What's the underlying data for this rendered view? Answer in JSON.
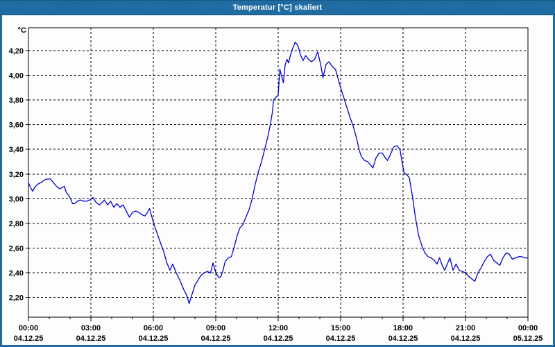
{
  "window": {
    "title": "Temperatur [°C] skaliert",
    "titlebar_color": "#1C6BA4",
    "border_color": "#1C6BA4",
    "background_color": "#FDFDFD"
  },
  "chart_data": {
    "type": "line",
    "title": "Temperatur [°C] skaliert",
    "unit_label": "°C",
    "line_color": "#0000CC",
    "grid": "dashed black, horizontal at every 0.20 °C, vertical at every 3 h",
    "legend_position": "none",
    "x_axis": {
      "range_hours": [
        0,
        24
      ],
      "minor_tick_interval_hours": 1,
      "tick_hours": [
        0,
        3,
        6,
        9,
        12,
        15,
        18,
        21,
        24
      ],
      "ticks": [
        {
          "time": "00:00",
          "date": "04.12.25"
        },
        {
          "time": "03:00",
          "date": "04.12.25"
        },
        {
          "time": "06:00",
          "date": "04.12.25"
        },
        {
          "time": "09:00",
          "date": "04.12.25"
        },
        {
          "time": "12:00",
          "date": "04.12.25"
        },
        {
          "time": "15:00",
          "date": "04.12.25"
        },
        {
          "time": "18:00",
          "date": "04.12.25"
        },
        {
          "time": "21:00",
          "date": "04.12.25"
        },
        {
          "time": "00:00",
          "date": "05.12.25"
        }
      ]
    },
    "y_axis": {
      "range": [
        1.78,
        4.39
      ],
      "tick_values": [
        2.2,
        2.4,
        2.6,
        2.8,
        3.0,
        3.2,
        3.4,
        3.6,
        3.8,
        4.0,
        4.2
      ],
      "tick_labels": [
        "2,20",
        "2,40",
        "2,60",
        "2,80",
        "3,00",
        "3,20",
        "3,40",
        "3,60",
        "3,80",
        "4,00",
        "4,20"
      ]
    },
    "series": [
      {
        "name": "Temperatur",
        "x_hours": [
          0,
          0.1,
          0.2,
          0.33,
          0.47,
          0.6,
          0.75,
          0.9,
          1.05,
          1.2,
          1.35,
          1.5,
          1.62,
          1.72,
          1.82,
          1.92,
          2.02,
          2.12,
          2.22,
          2.35,
          2.5,
          2.65,
          2.8,
          2.95,
          3.1,
          3.25,
          3.4,
          3.55,
          3.65,
          3.8,
          3.95,
          4.1,
          4.25,
          4.4,
          4.55,
          4.7,
          4.85,
          5.0,
          5.15,
          5.3,
          5.45,
          5.6,
          5.72,
          5.82,
          6.0,
          6.2,
          6.37,
          6.5,
          6.65,
          6.8,
          6.93,
          7.1,
          7.3,
          7.47,
          7.6,
          7.72,
          7.85,
          8.0,
          8.15,
          8.3,
          8.45,
          8.6,
          8.75,
          8.87,
          9.0,
          9.15,
          9.25,
          9.35,
          9.45,
          9.6,
          9.75,
          9.87,
          10.03,
          10.15,
          10.3,
          10.45,
          10.6,
          10.75,
          10.9,
          11.05,
          11.2,
          11.35,
          11.5,
          11.62,
          11.72,
          11.78,
          11.88,
          12.0,
          12.08,
          12.17,
          12.25,
          12.33,
          12.42,
          12.5,
          12.58,
          12.7,
          12.82,
          12.95,
          13.08,
          13.2,
          13.32,
          13.45,
          13.6,
          13.75,
          13.9,
          14.05,
          14.15,
          14.3,
          14.45,
          14.6,
          14.75,
          14.9,
          15.0,
          15.15,
          15.3,
          15.45,
          15.6,
          15.75,
          15.9,
          16.0,
          16.15,
          16.3,
          16.45,
          16.55,
          16.7,
          16.85,
          17.0,
          17.15,
          17.25,
          17.4,
          17.55,
          17.7,
          17.85,
          17.95,
          18.05,
          18.2,
          18.3,
          18.45,
          18.6,
          18.75,
          18.9,
          19.05,
          19.2,
          19.35,
          19.5,
          19.63,
          19.75,
          19.88,
          20.0,
          20.1,
          20.25,
          20.4,
          20.55,
          20.7,
          20.85,
          21.0,
          21.15,
          21.3,
          21.45,
          21.6,
          21.75,
          21.9,
          22.05,
          22.2,
          22.35,
          22.5,
          22.65,
          22.8,
          22.95,
          23.1,
          23.25,
          23.4,
          23.55,
          23.7,
          23.85,
          24.0
        ],
        "values": [
          3.13,
          3.09,
          3.06,
          3.1,
          3.12,
          3.13,
          3.15,
          3.16,
          3.16,
          3.13,
          3.1,
          3.08,
          3.09,
          3.1,
          3.05,
          3.03,
          3.0,
          2.96,
          2.96,
          2.98,
          2.99,
          2.98,
          2.98,
          2.99,
          3.01,
          2.97,
          2.95,
          2.97,
          2.99,
          2.95,
          2.98,
          2.93,
          2.96,
          2.93,
          2.95,
          2.9,
          2.85,
          2.89,
          2.9,
          2.89,
          2.87,
          2.86,
          2.89,
          2.92,
          2.81,
          2.71,
          2.63,
          2.57,
          2.48,
          2.42,
          2.47,
          2.4,
          2.33,
          2.26,
          2.22,
          2.15,
          2.22,
          2.3,
          2.34,
          2.38,
          2.4,
          2.41,
          2.4,
          2.48,
          2.4,
          2.36,
          2.37,
          2.42,
          2.49,
          2.52,
          2.53,
          2.6,
          2.7,
          2.76,
          2.79,
          2.85,
          2.91,
          3.0,
          3.12,
          3.22,
          3.3,
          3.4,
          3.5,
          3.6,
          3.7,
          3.8,
          3.82,
          3.84,
          4.05,
          3.99,
          3.94,
          4.08,
          4.13,
          4.1,
          4.16,
          4.22,
          4.27,
          4.24,
          4.16,
          4.12,
          4.16,
          4.13,
          4.11,
          4.13,
          4.19,
          4.08,
          3.98,
          4.09,
          4.11,
          4.07,
          4.05,
          3.96,
          3.9,
          3.82,
          3.74,
          3.66,
          3.59,
          3.5,
          3.39,
          3.34,
          3.31,
          3.3,
          3.27,
          3.25,
          3.33,
          3.37,
          3.37,
          3.33,
          3.31,
          3.36,
          3.42,
          3.43,
          3.4,
          3.3,
          3.21,
          3.19,
          3.17,
          3.02,
          2.84,
          2.7,
          2.62,
          2.56,
          2.53,
          2.52,
          2.5,
          2.47,
          2.52,
          2.46,
          2.42,
          2.46,
          2.52,
          2.42,
          2.47,
          2.42,
          2.41,
          2.4,
          2.37,
          2.35,
          2.33,
          2.4,
          2.44,
          2.49,
          2.53,
          2.55,
          2.5,
          2.48,
          2.46,
          2.52,
          2.56,
          2.55,
          2.51,
          2.52,
          2.53,
          2.53,
          2.52,
          2.52
        ]
      }
    ]
  }
}
